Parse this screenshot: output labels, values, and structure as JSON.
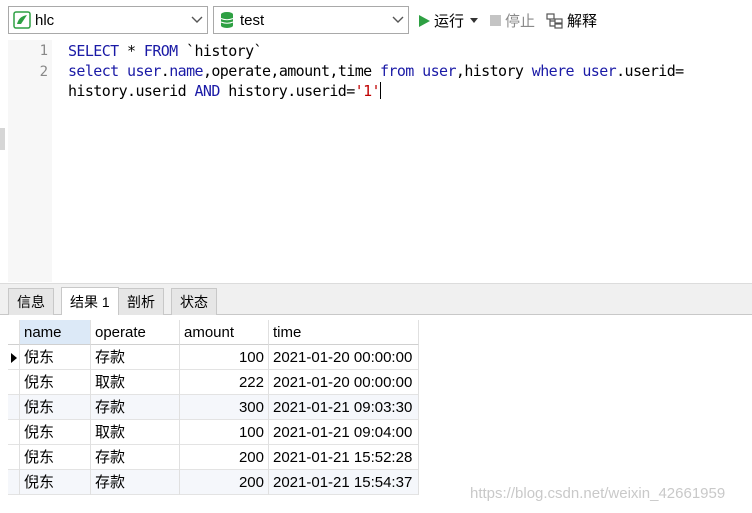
{
  "toolbar": {
    "connection": "hlc",
    "database": "test",
    "run_label": "运行",
    "stop_label": "停止",
    "explain_label": "解释"
  },
  "editor": {
    "line_numbers": [
      "1",
      "2"
    ]
  },
  "tabs": [
    {
      "label": "信息"
    },
    {
      "label": "结果 1"
    },
    {
      "label": "剖析"
    },
    {
      "label": "状态"
    }
  ],
  "results": {
    "columns": [
      "name",
      "operate",
      "amount",
      "time"
    ],
    "rows": [
      {
        "name": "倪东",
        "operate": "存款",
        "amount": "100",
        "time": "2021-01-20 00:00:00"
      },
      {
        "name": "倪东",
        "operate": "取款",
        "amount": "222",
        "time": "2021-01-20 00:00:00"
      },
      {
        "name": "倪东",
        "operate": "存款",
        "amount": "300",
        "time": "2021-01-21 09:03:30"
      },
      {
        "name": "倪东",
        "operate": "取款",
        "amount": "100",
        "time": "2021-01-21 09:04:00"
      },
      {
        "name": "倪东",
        "operate": "存款",
        "amount": "200",
        "time": "2021-01-21 15:52:28"
      },
      {
        "name": "倪东",
        "operate": "存款",
        "amount": "200",
        "time": "2021-01-21 15:54:37"
      }
    ]
  },
  "watermark": "https://blog.csdn.net/weixin_42661959",
  "colors": {
    "keyword": "#1a1aa6",
    "string": "#c00000",
    "run_icon": "#2ea043",
    "db_icon": "#2ea043"
  }
}
